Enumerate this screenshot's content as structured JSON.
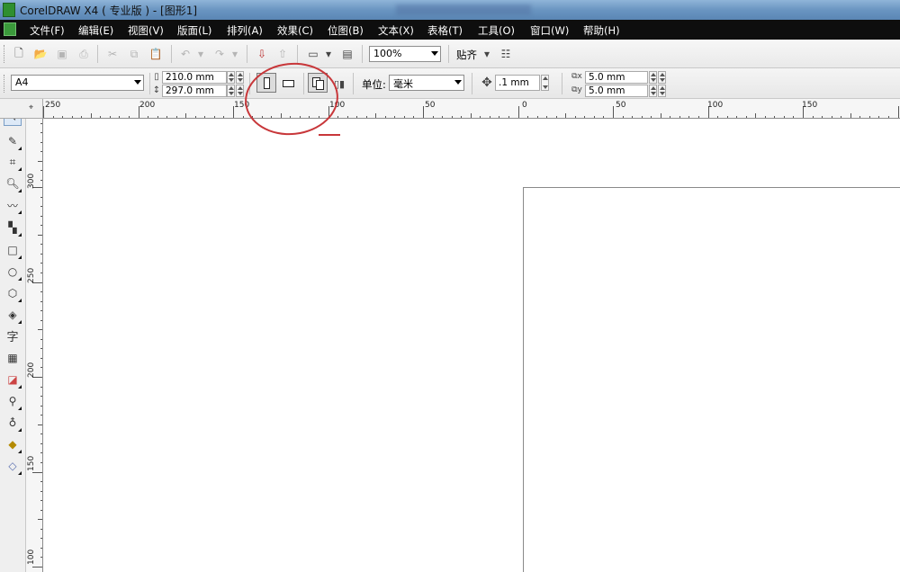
{
  "window": {
    "title": "CorelDRAW X4 ( 专业版 ) - [图形1]"
  },
  "menu": {
    "items": [
      {
        "label": "文件(F)"
      },
      {
        "label": "编辑(E)"
      },
      {
        "label": "视图(V)"
      },
      {
        "label": "版面(L)"
      },
      {
        "label": "排列(A)"
      },
      {
        "label": "效果(C)"
      },
      {
        "label": "位图(B)"
      },
      {
        "label": "文本(X)"
      },
      {
        "label": "表格(T)"
      },
      {
        "label": "工具(O)"
      },
      {
        "label": "窗口(W)"
      },
      {
        "label": "帮助(H)"
      }
    ]
  },
  "standard_toolbar": {
    "zoom": "100%",
    "snap_label": "贴齐"
  },
  "property_bar": {
    "page_size": "A4",
    "width": "210.0 mm",
    "height": "297.0 mm",
    "units_label": "单位:",
    "units_value": "毫米",
    "nudge": ".1 mm",
    "dup_x": "5.0 mm",
    "dup_y": "5.0 mm"
  },
  "rulers": {
    "horizontal": [
      "250",
      "200",
      "150",
      "100",
      "50",
      "0",
      "50",
      "100",
      "150"
    ],
    "vertical": [
      "300",
      "250",
      "200",
      "150",
      "100"
    ]
  },
  "toolbox": {
    "text_tool_glyph": "字"
  },
  "colors": {
    "annotation": "#c8373a",
    "menubar": "#0e0e0e"
  }
}
